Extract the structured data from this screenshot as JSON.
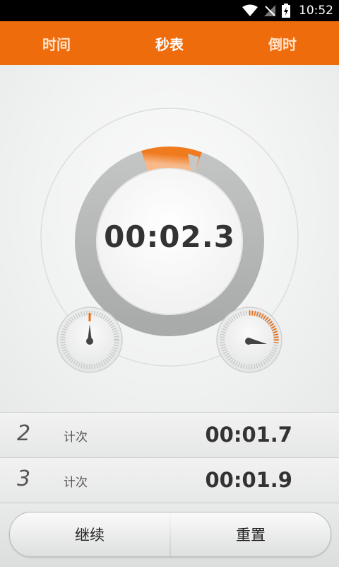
{
  "status_bar": {
    "time": "10:52"
  },
  "tabs": [
    {
      "label": "时间",
      "active": false
    },
    {
      "label": "秒表",
      "active": true
    },
    {
      "label": "倒时",
      "active": false
    }
  ],
  "stopwatch": {
    "elapsed": "00:02.3",
    "progress_fraction": 0.23
  },
  "laps": [
    {
      "number": "2",
      "label": "计次",
      "time": "00:01.7"
    },
    {
      "number": "3",
      "label": "计次",
      "time": "00:01.9"
    }
  ],
  "controls": {
    "resume_label": "继续",
    "reset_label": "重置"
  },
  "colors": {
    "accent": "#ee6c0c",
    "text": "#333333"
  }
}
